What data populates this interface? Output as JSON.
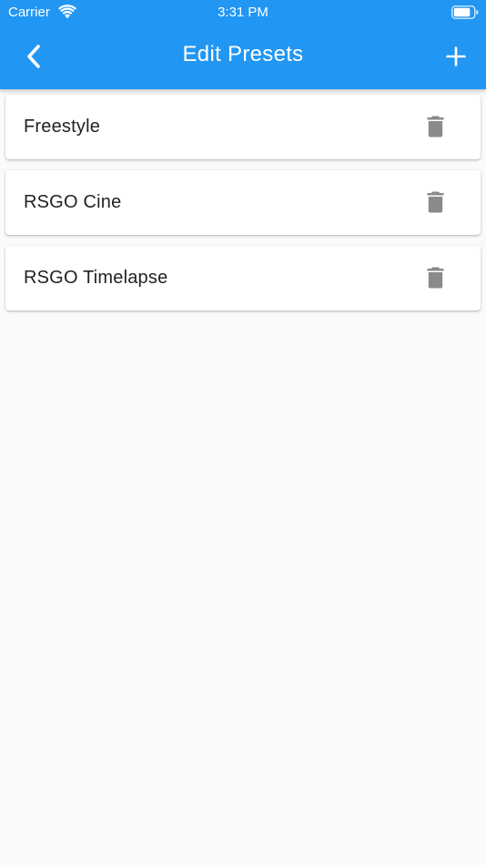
{
  "status_bar": {
    "carrier": "Carrier",
    "time": "3:31 PM"
  },
  "header": {
    "title": "Edit Presets",
    "back_icon": "chevron-left-icon",
    "add_icon": "plus-icon",
    "background_color": "#2196f3"
  },
  "presets": [
    {
      "name": "Freestyle",
      "action_icon": "trash-icon"
    },
    {
      "name": "RSGO Cine",
      "action_icon": "trash-icon"
    },
    {
      "name": "RSGO Timelapse",
      "action_icon": "trash-icon"
    }
  ],
  "colors": {
    "accent": "#2196f3",
    "background": "#fafafa",
    "card": "#ffffff",
    "delete_icon": "#8a8a8a"
  }
}
